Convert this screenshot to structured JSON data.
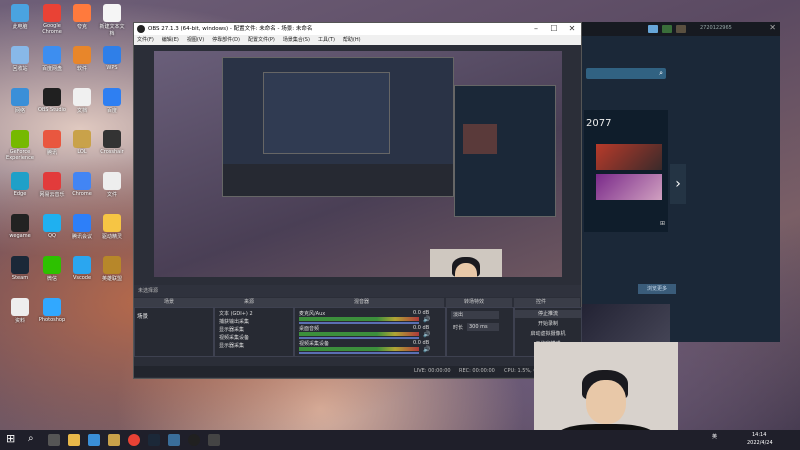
{
  "desktop": {
    "icons": [
      {
        "label": "此电脑",
        "color": "#4aa3e0"
      },
      {
        "label": "Google Chrome",
        "color": "#e94235"
      },
      {
        "label": "夸克",
        "color": "#ff7a3d"
      },
      {
        "label": "新建文本文档",
        "color": "#f5f5f5"
      },
      {
        "label": "回收站",
        "color": "#88b8e8"
      },
      {
        "label": "百度网盘",
        "color": "#3d8ef0"
      },
      {
        "label": "软件",
        "color": "#e8862a"
      },
      {
        "label": "WPS",
        "color": "#2f7fe8"
      },
      {
        "label": "网络",
        "color": "#3a8fd8"
      },
      {
        "label": "OBS Studio",
        "color": "#202020"
      },
      {
        "label": "文档",
        "color": "#f0f0f0"
      },
      {
        "label": "百度",
        "color": "#2e7ff2"
      },
      {
        "label": "GeForce Experience",
        "color": "#76b900"
      },
      {
        "label": "腾讯",
        "color": "#e9573f"
      },
      {
        "label": "LOL",
        "color": "#c9a24a"
      },
      {
        "label": "Crosshair",
        "color": "#333"
      },
      {
        "label": "Edge",
        "color": "#1fa0c8"
      },
      {
        "label": "网易云音乐",
        "color": "#e23b3b"
      },
      {
        "label": "Chrome",
        "color": "#4285f4"
      },
      {
        "label": "文件",
        "color": "#eee"
      },
      {
        "label": "wegame",
        "color": "#222"
      },
      {
        "label": "QQ",
        "color": "#1fb0f0"
      },
      {
        "label": "腾讯会议",
        "color": "#2d7ff9"
      },
      {
        "label": "驱动精灵",
        "color": "#f6c544"
      },
      {
        "label": "Steam",
        "color": "#1b2838"
      },
      {
        "label": "微信",
        "color": "#2dc100"
      },
      {
        "label": "Vscode",
        "color": "#2aa6f0"
      },
      {
        "label": "英雄联盟",
        "color": "#b7872a"
      },
      {
        "label": "资料",
        "color": "#eee"
      },
      {
        "label": "Photoshop",
        "color": "#31a8ff"
      }
    ]
  },
  "obs": {
    "title": "OBS 27.1.3 (64-bit, windows) - 配置文件: 未命名 - 场景: 未命名",
    "menu": [
      "文件(F)",
      "编辑(E)",
      "视图(V)",
      "停靠部件(D)",
      "配置文件(P)",
      "场景集合(S)",
      "工具(T)",
      "帮助(H)"
    ],
    "panels": {
      "scenes_header": "场景",
      "sources_header": "来源",
      "mixer_header": "混音器",
      "transitions_header": "转场特效",
      "controls_header": "控件"
    },
    "scene_name": "场景",
    "sources": [
      "文本 (GDI+) 2",
      "捕获输出采集",
      "显示器采集",
      "视频采集设备",
      "显示器采集"
    ],
    "mixer": [
      {
        "name": "麦克风/Aux",
        "db": "0.0 dB"
      },
      {
        "name": "桌面音频",
        "db": "0.0 dB"
      },
      {
        "name": "视频采集设备",
        "db": "0.0 dB"
      }
    ],
    "transition": {
      "value": "淡出",
      "duration_label": "时长",
      "duration": "300 ms"
    },
    "controls": [
      "停止推流",
      "开始录制",
      "启动虚拟摄像机",
      "工作室模式"
    ],
    "no_source": "未选择源",
    "status": {
      "live": "LIVE: 00:00:00",
      "rec": "REC: 00:00:00",
      "cpu": "CPU: 1.5%, 60.00 fps"
    }
  },
  "steam": {
    "game_title": "2077",
    "more_button": "浏览更多",
    "user": "2720122965"
  },
  "taskbar": {
    "time": "14:14",
    "date": "2022/4/24",
    "lang": "英"
  }
}
